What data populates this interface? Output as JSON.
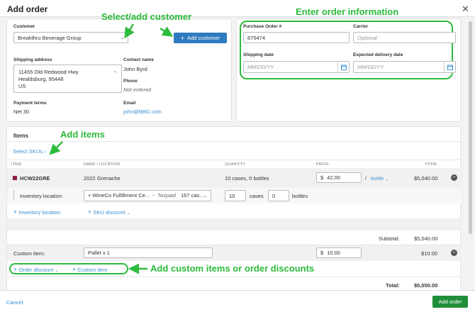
{
  "header": {
    "title": "Add order",
    "close_icon": "close-icon"
  },
  "customer": {
    "label": "Customer",
    "selected": "Breakthru Beverage Group",
    "add_button": "Add customer",
    "shipping_label": "Shipping address",
    "shipping_line1": "11455 Old Redwood Hwy",
    "shipping_line2": "Healdsburg, 95448",
    "shipping_line3": "US",
    "contact_label": "Contact name",
    "contact_value": "John Byrd",
    "phone_label": "Phone",
    "phone_value": "Not entered",
    "terms_label": "Payment terms",
    "terms_value": "Net 30",
    "email_label": "Email",
    "email_value": "john@BBG.com"
  },
  "order_info": {
    "po_label": "Purchase Order #",
    "po_value": "875474",
    "carrier_label": "Carrier",
    "carrier_placeholder": "Optional",
    "ship_date_label": "Shipping date",
    "ship_date_placeholder": "MM/DD/YY",
    "delivery_label": "Expected delivery date",
    "delivery_placeholder": "MM/DD/YY"
  },
  "items": {
    "section_title": "Items",
    "select_skus": "Select SKUs",
    "columns": [
      "ITEM",
      "NAME / LOCATION",
      "QUANTITY",
      "PRICE",
      "TOTAL"
    ],
    "row": {
      "sku": "HCW22GRE",
      "name": "2022 Grenache",
      "quantity": "10 cases, 0 bottles",
      "price_symbol": "$",
      "price": "42.00",
      "unit_sep": "/",
      "unit": "bottle",
      "total": "$5,040.00"
    },
    "inventory": {
      "label": "Inventory location:",
      "location": "WineCo Fulfillment Ce...",
      "status": "Taxpaid",
      "available": "167 cas...",
      "cases_value": "10",
      "cases_label": "cases",
      "bottles_value": "0",
      "bottles_label": "bottles"
    },
    "add_inventory_link": "Inventory location",
    "sku_discount_link": "SKU discount",
    "subtotal_label": "Subtotal:",
    "subtotal_value": "$5,040.00",
    "custom_label": "Custom item:",
    "custom_value": "Pallet x 1",
    "custom_price_symbol": "$",
    "custom_price": "10.00",
    "custom_total": "$10.00",
    "order_discount": "Order discount",
    "custom_item": "Custom item",
    "total_label": "Total:",
    "total_value": "$5,050.00"
  },
  "footer": {
    "cancel": "Cancel",
    "submit": "Add order"
  },
  "annotations": {
    "select_customer": "Select/add customer",
    "order_info": "Enter order information",
    "add_items": "Add items",
    "custom_items": "Add custom items or order discounts"
  },
  "colors": {
    "annotation": "#2dbb3c",
    "primary": "#2f7bbf",
    "submit": "#1f8f3a",
    "link": "#3b8fd1"
  }
}
